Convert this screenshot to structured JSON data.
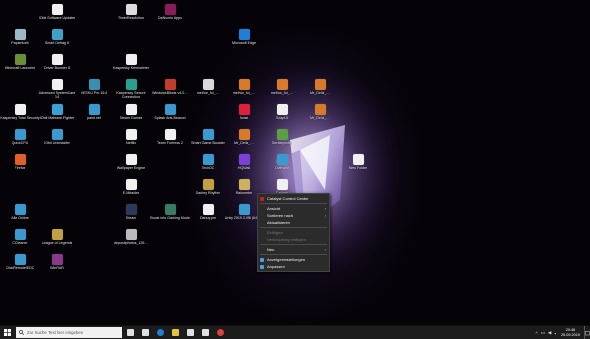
{
  "desktop": {
    "icons": [
      {
        "label": "IObit Software Updater",
        "icon": "file-icon",
        "color": "#f0f0f0"
      },
      {
        "label": "TimerResolution",
        "icon": "clock-icon",
        "color": "#dddddd"
      },
      {
        "label": "DeNumio Apps",
        "icon": "app-icon",
        "color": "#8b1c5b"
      },
      {
        "label": "Papierkorb",
        "icon": "recycle-bin-icon",
        "color": "#9fb8c8"
      },
      {
        "label": "Smart Defrag 6",
        "icon": "defrag-icon",
        "color": "#3fa0c8"
      },
      {
        "label": "Microsoft Edge",
        "icon": "edge-icon",
        "color": "#1f7fd6"
      },
      {
        "label": "Minecraft Launcher",
        "icon": "minecraft-icon",
        "color": "#6a8f3a"
      },
      {
        "label": "Driver Booster 8",
        "icon": "file-icon",
        "color": "#f0f0f0"
      },
      {
        "label": "Kaspersky Kennwörter",
        "icon": "file-icon",
        "color": "#f0f0f0"
      },
      {
        "label": "Advanced SystemCare 14",
        "icon": "file-icon",
        "color": "#f0f0f0"
      },
      {
        "label": "VESKU Pro 16.6",
        "icon": "app-icon",
        "color": "#3a8fb0"
      },
      {
        "label": "Kaspersky Secure Connection",
        "icon": "app-icon",
        "color": "#2a9f8f"
      },
      {
        "label": "WindowsBlinds v4.0…",
        "icon": "app-icon",
        "color": "#c43c2c"
      },
      {
        "label": "melhor_foi_…",
        "icon": "file-icon",
        "color": "#d8d8d8"
      },
      {
        "label": "melhor_foi_…",
        "icon": "app-icon",
        "color": "#d87a2a"
      },
      {
        "label": "melhor_foi_…",
        "icon": "app-icon",
        "color": "#d87a2a"
      },
      {
        "label": "Mr_Deliz_…",
        "icon": "app-icon",
        "color": "#d87a2a"
      },
      {
        "label": "Kaspersky Total Security",
        "icon": "file-icon",
        "color": "#f0f0f0"
      },
      {
        "label": "IObit Malware Fighter",
        "icon": "app-icon",
        "color": "#3aa0d8"
      },
      {
        "label": "paint.net",
        "icon": "app-icon",
        "color": "#3a9ad0"
      },
      {
        "label": "Steam Games",
        "icon": "file-icon",
        "color": "#f0f0f0"
      },
      {
        "label": "Splash Anti-Beacon",
        "icon": "app-icon",
        "color": "#3a9ad0"
      },
      {
        "label": "Avast",
        "icon": "app-icon",
        "color": "#e0203a"
      },
      {
        "label": "SoapUI",
        "icon": "file-icon",
        "color": "#f0f0f0"
      },
      {
        "label": "Mr_Deliz_…",
        "icon": "app-icon",
        "color": "#d87a2a"
      },
      {
        "label": "QuickCPU",
        "icon": "app-icon",
        "color": "#3a9ad0"
      },
      {
        "label": "IObit Uninstaller",
        "icon": "app-icon",
        "color": "#3a9ad0"
      },
      {
        "label": "Netflix",
        "icon": "file-icon",
        "color": "#f0f0f0"
      },
      {
        "label": "Team Fortress 2",
        "icon": "file-icon",
        "color": "#f0f0f0"
      },
      {
        "label": "Smart Game Booster",
        "icon": "app-icon",
        "color": "#3a9ad0"
      },
      {
        "label": "Mr_Deliz_…",
        "icon": "app-icon",
        "color": "#d87a2a"
      },
      {
        "label": "Geräteprofile",
        "icon": "app-icon",
        "color": "#5aa040"
      },
      {
        "label": "Firefox",
        "icon": "firefox-icon",
        "color": "#e0602a"
      },
      {
        "label": "Wallpaper Engine",
        "icon": "file-icon",
        "color": "#f0f0f0"
      },
      {
        "label": "TechDC",
        "icon": "app-icon",
        "color": "#3a9ad0"
      },
      {
        "label": "HQWall",
        "icon": "app-icon",
        "color": "#7a40d8"
      },
      {
        "label": "Overwolf",
        "icon": "app-icon",
        "color": "#3a9ad0"
      },
      {
        "label": "New Folder",
        "icon": "file-icon",
        "color": "#f0f0f0"
      },
      {
        "label": "E-Mitalder",
        "icon": "file-icon",
        "color": "#f0f0f0"
      },
      {
        "label": "Darkey Rhythm",
        "icon": "app-icon",
        "color": "#c0a040"
      },
      {
        "label": "Rainmeter",
        "icon": "app-icon",
        "color": "#d0b060"
      },
      {
        "label": "Cachey",
        "icon": "file-icon",
        "color": "#f0f0f0"
      },
      {
        "label": "Alle Online",
        "icon": "app-icon",
        "color": "#3a9ad0"
      },
      {
        "label": "Steam",
        "icon": "app-icon",
        "color": "#2a3a5a"
      },
      {
        "label": "Boost into Gaming Mode",
        "icon": "app-icon",
        "color": "#3a7a60"
      },
      {
        "label": "Danuy.pm",
        "icon": "file-icon",
        "color": "#f0f0f0"
      },
      {
        "label": "Unity 2019.3.0f6 (64-bit)",
        "icon": "app-icon",
        "color": "#3a9ad0"
      },
      {
        "label": "CCleaner",
        "icon": "app-icon",
        "color": "#3a9ad0"
      },
      {
        "label": "League of Legends",
        "icon": "app-icon",
        "color": "#c0a040"
      },
      {
        "label": "depositphotos_126…",
        "icon": "file-icon",
        "color": "#bbbbbb"
      },
      {
        "label": "ClickRemote/EDC",
        "icon": "app-icon",
        "color": "#3a9ad0"
      },
      {
        "label": "WinRAR",
        "icon": "winrar-icon",
        "color": "#8a3a8a"
      }
    ]
  },
  "context_menu": {
    "items": [
      {
        "label": "Catalyst Control Center",
        "disabled": false,
        "submenu": false,
        "icon": "ccc-icon",
        "icon_color": "#c0202a"
      },
      {
        "sep": true
      },
      {
        "label": "Ansicht",
        "disabled": false,
        "submenu": true
      },
      {
        "label": "Sortieren nach",
        "disabled": false,
        "submenu": true
      },
      {
        "label": "Aktualisieren",
        "disabled": false,
        "submenu": false
      },
      {
        "sep": true
      },
      {
        "label": "Einfügen",
        "disabled": true,
        "submenu": false
      },
      {
        "label": "Verknüpfung einfügen",
        "disabled": true,
        "submenu": false
      },
      {
        "sep": true
      },
      {
        "label": "Neu",
        "disabled": false,
        "submenu": true
      },
      {
        "sep": true
      },
      {
        "label": "Anzeigeeinstellungen",
        "disabled": false,
        "submenu": false,
        "icon": "display-settings-icon",
        "icon_color": "#4aa0e0"
      },
      {
        "label": "Anpassen",
        "disabled": false,
        "submenu": false,
        "icon": "personalize-icon",
        "icon_color": "#4aa0e0"
      }
    ]
  },
  "taskbar": {
    "search_placeholder": "Zur Suche Text hier eingeben",
    "pinned": [
      {
        "icon": "task-view-icon",
        "color": "#e0e0e0"
      },
      {
        "icon": "multitask-icon",
        "color": "#e0e0e0"
      },
      {
        "icon": "edge-icon",
        "color": "#1f7fd6"
      },
      {
        "icon": "file-explorer-icon",
        "color": "#e8c040"
      },
      {
        "icon": "store-icon",
        "color": "#e0e0e0"
      },
      {
        "icon": "mail-icon",
        "color": "#e0e0e0"
      },
      {
        "icon": "chrome-icon",
        "color": "#e0403a"
      }
    ],
    "tray": {
      "time": "20:46",
      "date": "25.09.2019"
    }
  }
}
